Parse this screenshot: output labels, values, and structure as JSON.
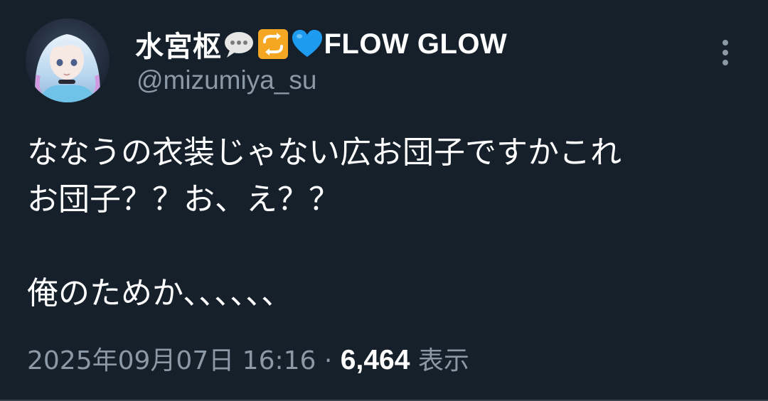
{
  "author": {
    "name_prefix": "水宮枢",
    "name_suffix": "FLOW GLOW",
    "handle": "@mizumiya_su",
    "name_emojis": [
      "speech-balloon-icon",
      "repeat-arrows-icon",
      "blue-heart-icon"
    ]
  },
  "tweet": {
    "lines": [
      "ななうの衣装じゃない広お団子ですかこれ",
      "お団子？？お、え？？",
      "",
      "俺のためか、、、、、、"
    ],
    "timestamp": "2025年09月07日 16:16",
    "separator": "·",
    "views_count": "6,464",
    "views_label": "表示"
  },
  "theme": {
    "background": "#15202b",
    "text_primary": "#ffffff",
    "text_secondary": "#8b98a5",
    "blue_heart": "#1d9bf0",
    "repeat_tile": "#f5a623"
  },
  "icons": {
    "more": "more-vertical-icon"
  }
}
